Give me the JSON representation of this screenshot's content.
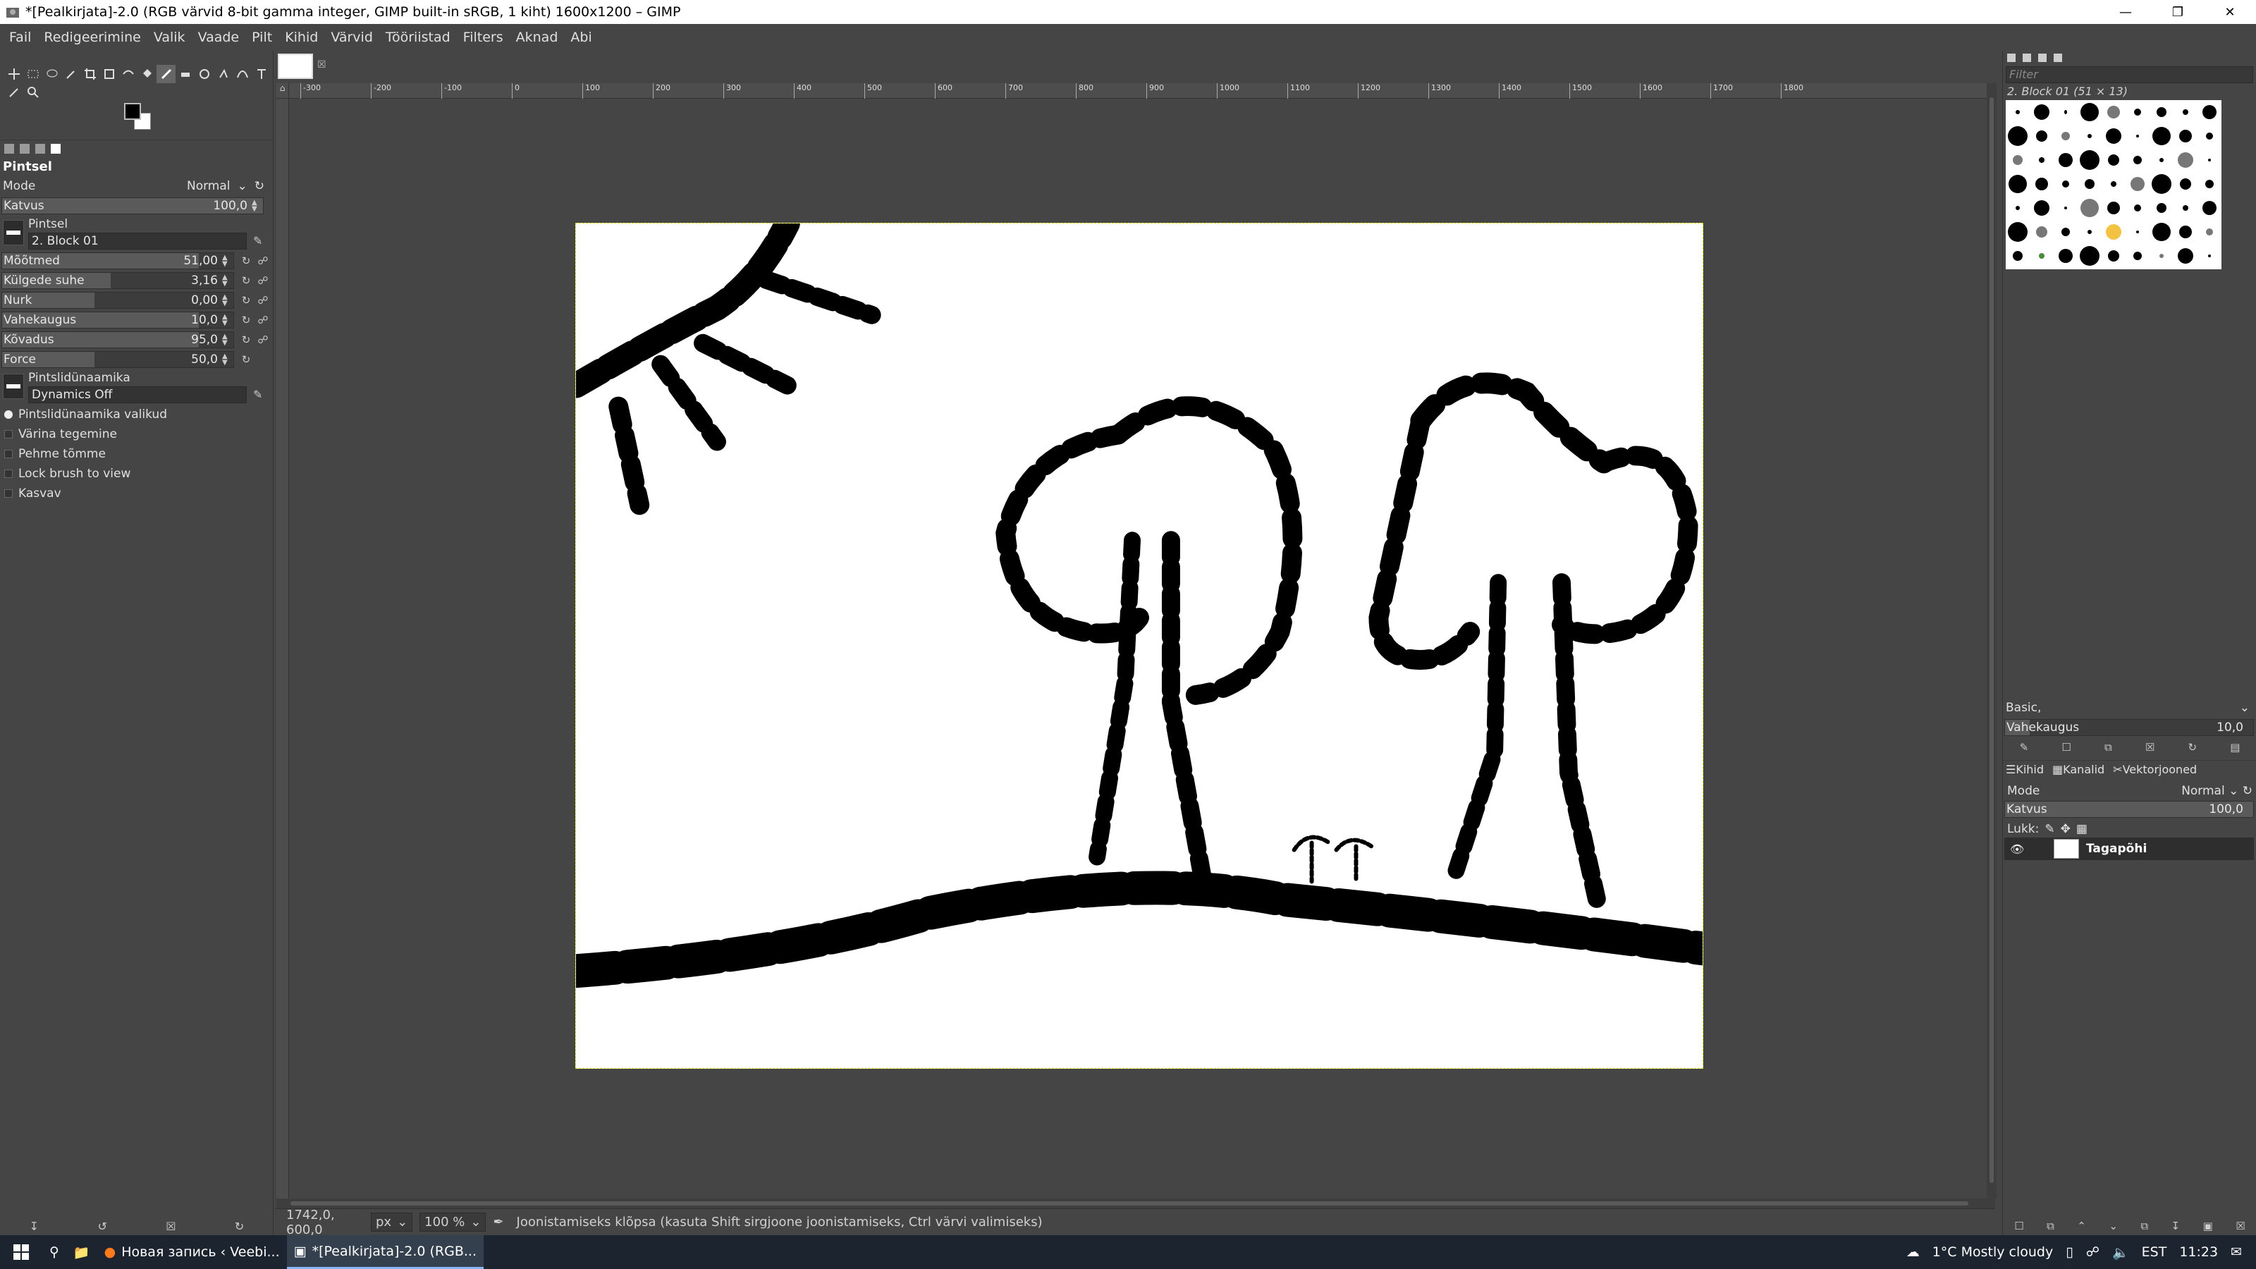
{
  "window": {
    "title": "*[Pealkirjata]-2.0 (RGB värvid 8-bit gamma integer, GIMP built-in sRGB, 1 kiht) 1600x1200 – GIMP"
  },
  "menu": [
    "Fail",
    "Redigeerimine",
    "Valik",
    "Vaade",
    "Pilt",
    "Kihid",
    "Värvid",
    "Tööriistad",
    "Filters",
    "Aknad",
    "Abi"
  ],
  "tool_options": {
    "title": "Pintsel",
    "mode_label": "Mode",
    "mode_value": "Normal",
    "opacity": {
      "label": "Katvus",
      "value": "100,0"
    },
    "brush_label": "Pintsel",
    "brush_name": "2. Block 01",
    "sliders": [
      {
        "label": "Mõõtmed",
        "value": "51,00",
        "fill": 0.85
      },
      {
        "label": "Külgede suhe",
        "value": "3,16",
        "fill": 0.47
      },
      {
        "label": "Nurk",
        "value": "0,00",
        "fill": 0.4
      },
      {
        "label": "Vahekaugus",
        "value": "10,0",
        "fill": 0.85
      },
      {
        "label": "Kõvadus",
        "value": "95,0",
        "fill": 0.85
      },
      {
        "label": "Force",
        "value": "50,0",
        "fill": 0.4
      }
    ],
    "dynamics_label": "Pintslidünaamika",
    "dynamics_value": "Dynamics Off",
    "checks": [
      {
        "label": "Pintslidünaamika valikud",
        "on": true
      },
      {
        "label": "Värina tegemine",
        "on": false
      },
      {
        "label": "Pehme tõmme",
        "on": false
      },
      {
        "label": "Lock brush to view",
        "on": false
      },
      {
        "label": "Kasvav",
        "on": false
      }
    ]
  },
  "ruler_ticks": [
    "-300",
    "-200",
    "-100",
    "0",
    "100",
    "200",
    "300",
    "400",
    "500",
    "600",
    "700",
    "800",
    "900",
    "1000",
    "1100",
    "1200",
    "1300",
    "1400",
    "1500",
    "1600",
    "1700",
    "1800"
  ],
  "statusbar": {
    "coords": "1742,0, 600,0",
    "unit": "px",
    "zoom": "100 %",
    "message": "Joonistamiseks klõpsa (kasuta Shift sirgjoone joonistamiseks, Ctrl värvi valimiseks)"
  },
  "right_panel": {
    "filter_placeholder": "Filter",
    "brush_title": "2. Block 01 (51 × 13)",
    "preset": "Basic,",
    "spacing": {
      "label": "Vahekaugus",
      "value": "10,0"
    },
    "layer_tabs": [
      "Kihid",
      "Kanalid",
      "Vektorjooned"
    ],
    "layers_mode_label": "Mode",
    "layers_mode_value": "Normal",
    "layers_opacity": {
      "label": "Katvus",
      "value": "100,0"
    },
    "lock_label": "Lukk:",
    "layer_name": "Tagapõhi"
  },
  "taskbar": {
    "items": [
      "Новая запись ‹ Veebi...",
      "*[Pealkirjata]-2.0 (RGB..."
    ],
    "weather": "1°C  Mostly cloudy",
    "lang": "EST",
    "time": "11:23"
  }
}
